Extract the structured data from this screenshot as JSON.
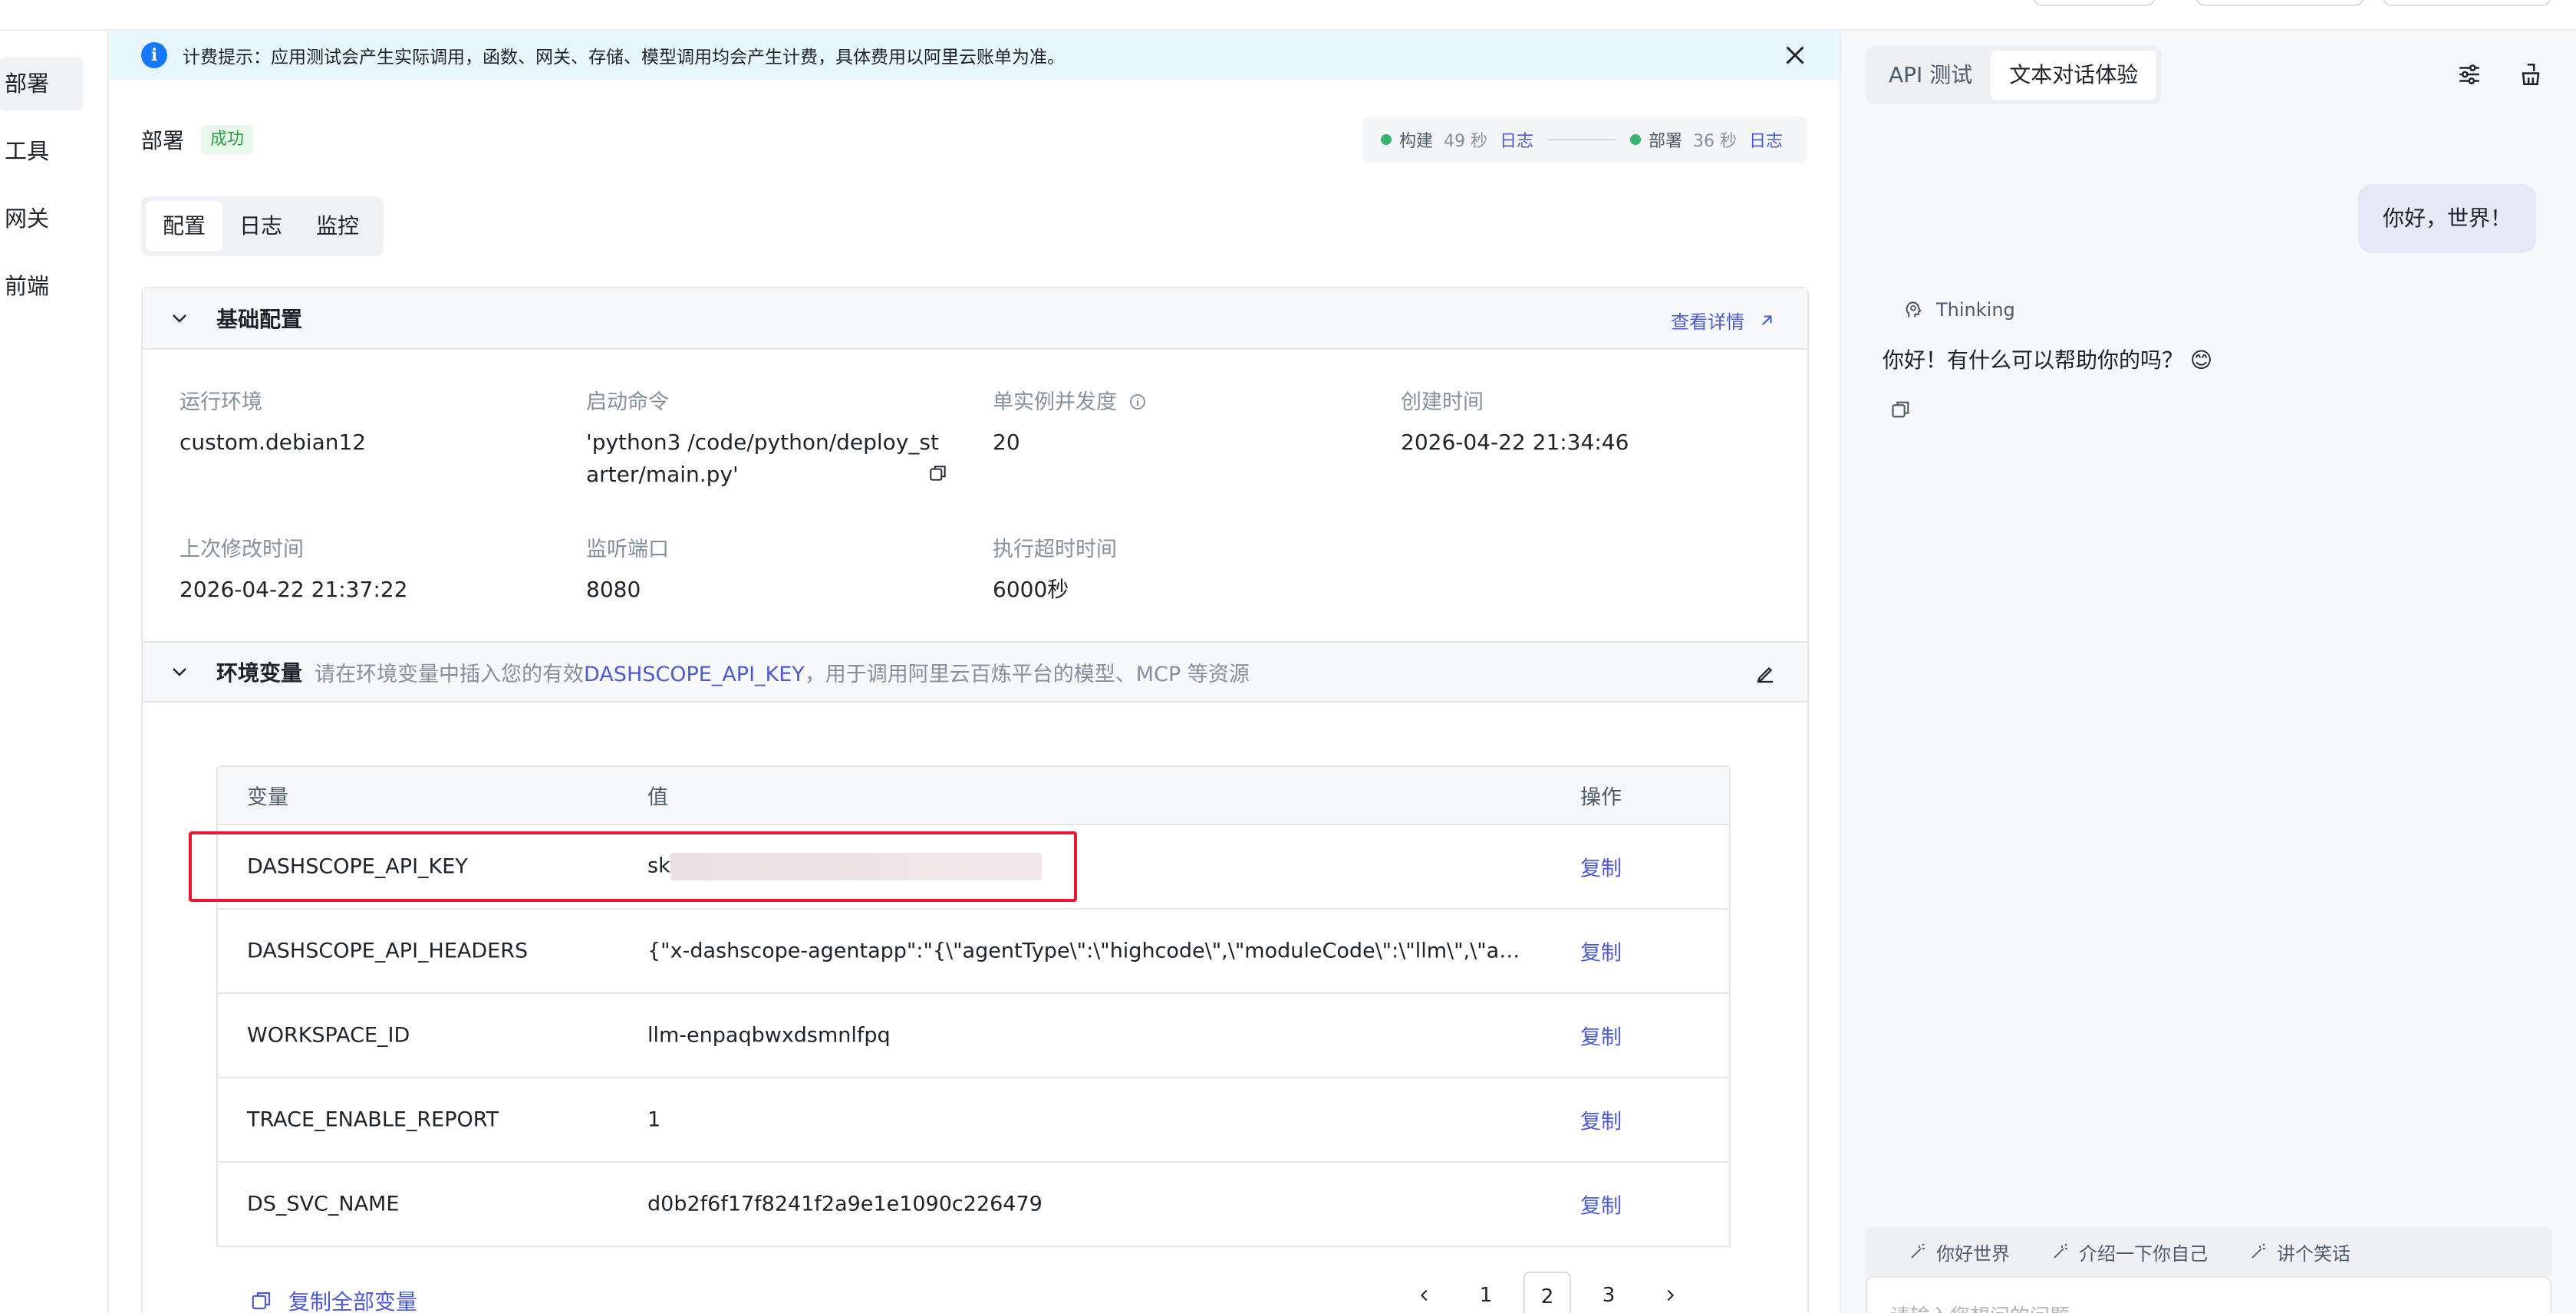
{
  "nav": {
    "items": [
      {
        "label": "部署",
        "active": true
      },
      {
        "label": "工具",
        "active": false
      },
      {
        "label": "网关",
        "active": false
      },
      {
        "label": "前端",
        "active": false
      }
    ]
  },
  "notice": {
    "text": "计费提示：应用测试会产生实际调用，函数、网关、存储、模型调用均会产生计费，具体费用以阿里云账单为准。"
  },
  "deploy": {
    "title": "部署",
    "status": "成功",
    "pipeline": {
      "build_label": "构建",
      "build_duration": "49 秒",
      "build_log": "日志",
      "deploy_label": "部署",
      "deploy_duration": "36 秒",
      "deploy_log": "日志"
    }
  },
  "tabs": [
    "配置",
    "日志",
    "监控"
  ],
  "basic": {
    "title": "基础配置",
    "detail_link": "查看详情",
    "fields": {
      "runtime": {
        "label": "运行环境",
        "value": "custom.debian12"
      },
      "start_cmd": {
        "label": "启动命令",
        "value_line1": "'python3 /code/python/deploy_st",
        "value_line2": "arter/main.py'"
      },
      "concurrency": {
        "label": "单实例并发度",
        "value": "20"
      },
      "created": {
        "label": "创建时间",
        "value": "2026-04-22 21:34:46"
      },
      "modified": {
        "label": "上次修改时间",
        "value": "2026-04-22 21:37:22"
      },
      "port": {
        "label": "监听端口",
        "value": "8080"
      },
      "timeout": {
        "label": "执行超时时间",
        "value": "6000秒"
      }
    }
  },
  "env": {
    "title": "环境变量",
    "hint_before": "请在环境变量中插入您的有效",
    "hint_key": "DASHSCOPE_API_KEY",
    "hint_after": "，用于调用阿里云百炼平台的模型、MCP 等资源",
    "columns": [
      "变量",
      "值",
      "操作"
    ],
    "rows": [
      {
        "name": "DASHSCOPE_API_KEY",
        "value": "sk",
        "action": "复制"
      },
      {
        "name": "DASHSCOPE_API_HEADERS",
        "value": "{\"x-dashscope-agentapp\":\"{\\\"agentType\\\":\\\"highcode\\\",\\\"moduleCode\\\":\\\"llm\\\",\\\"agentCode…",
        "action": "复制"
      },
      {
        "name": "WORKSPACE_ID",
        "value": "llm-enpaqbwxdsmnlfpq",
        "action": "复制"
      },
      {
        "name": "TRACE_ENABLE_REPORT",
        "value": "1",
        "action": "复制"
      },
      {
        "name": "DS_SVC_NAME",
        "value": "d0b2f6f17f8241f2a9e1e1090c226479",
        "action": "复制"
      }
    ],
    "copy_all": "复制全部变量",
    "pages": [
      "1",
      "2",
      "3"
    ],
    "current_page": "2"
  },
  "chat": {
    "tabs": [
      "API 测试",
      "文本对话体验"
    ],
    "active_tab": "文本对话体验",
    "user_message": "你好，世界！",
    "thinking_label": "Thinking",
    "reply": "你好！有什么可以帮助你的吗？ 😊",
    "suggestions": [
      "你好世界",
      "介绍一下你自己",
      "讲个笑话"
    ],
    "input_placeholder": "请输入您想问的问题"
  },
  "colors": {
    "accent": "#4c5bd4",
    "success": "#2ea043",
    "notice_bg": "#e8f7fe",
    "highlight_box": "#e8192c"
  }
}
